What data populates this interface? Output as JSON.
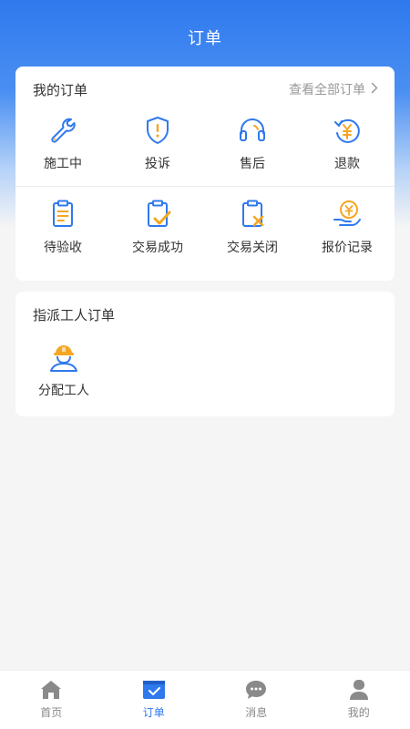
{
  "header": {
    "title": "订单"
  },
  "orders_card": {
    "title": "我的订单",
    "view_all": "查看全部订单",
    "items": [
      {
        "label": "施工中",
        "icon": "wrench-icon"
      },
      {
        "label": "投诉",
        "icon": "shield-alert-icon"
      },
      {
        "label": "售后",
        "icon": "headset-icon"
      },
      {
        "label": "退款",
        "icon": "refund-icon"
      },
      {
        "label": "待验收",
        "icon": "clipboard-icon"
      },
      {
        "label": "交易成功",
        "icon": "clipboard-check-icon"
      },
      {
        "label": "交易关闭",
        "icon": "clipboard-close-icon"
      },
      {
        "label": "报价记录",
        "icon": "quote-hand-icon"
      }
    ]
  },
  "assign_card": {
    "title": "指派工人订单",
    "item": {
      "label": "分配工人",
      "icon": "worker-helmet-icon"
    }
  },
  "tabbar": {
    "active": "订单",
    "tabs": [
      {
        "label": "首页",
        "icon": "home-icon"
      },
      {
        "label": "订单",
        "icon": "orders-icon"
      },
      {
        "label": "消息",
        "icon": "message-icon"
      },
      {
        "label": "我的",
        "icon": "profile-icon"
      }
    ]
  },
  "colors": {
    "primary": "#2f79ee",
    "accent": "#f5a623",
    "text": "#333333",
    "muted": "#999999"
  }
}
